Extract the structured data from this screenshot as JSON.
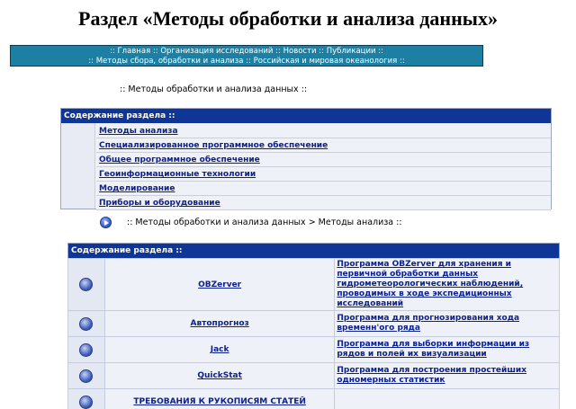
{
  "title": "Раздел «Методы обработки и анализа данных»",
  "nav": {
    "line1": [
      {
        "sep": ":: "
      },
      {
        "label": "Главная"
      },
      {
        "sep": " :: "
      },
      {
        "label": "Организация исследований"
      },
      {
        "sep": " :: "
      },
      {
        "label": "Новости"
      },
      {
        "sep": " :: "
      },
      {
        "label": "Публикации"
      },
      {
        "sep": " ::"
      }
    ],
    "line2": [
      {
        "sep": "::  "
      },
      {
        "label": "Методы сбора, обработки и анализа"
      },
      {
        "sep": " :: "
      },
      {
        "label": "Российская и мировая океанология"
      },
      {
        "sep": " ::"
      }
    ]
  },
  "breadcrumb1": ":: Методы обработки и анализа данных ::",
  "section1": {
    "header": "Содержание раздела ::",
    "items": [
      "Методы анализа",
      "Специализированное программное обеспечение",
      "Общее программное обеспечение",
      "Геоинформационные технологии",
      "Моделирование",
      "Приборы и оборудование"
    ]
  },
  "breadcrumb2": ":: Методы обработки и анализа данных > Методы анализа ::",
  "section2": {
    "header": "Содержание раздела ::",
    "rows": [
      {
        "name": "OBZerver",
        "desc": "Программа OBZerver для хранения и первичной обработки данных гидрометеорологических наблюдений, проводимых в ходе экспедиционных исследований"
      },
      {
        "name": "Автопрогноз",
        "desc": "Программа для прогнозирования хода временн'ого ряда"
      },
      {
        "name": "Jack",
        "desc": "Программа для выборки информации из рядов и полей их визуализации"
      },
      {
        "name": "QuickStat",
        "desc": "Программа для построения простейших одномерных статистик"
      },
      {
        "name": "ТРЕБОВАНИЯ К РУКОПИСЯМ СТАТЕЙ",
        "desc": ""
      }
    ]
  },
  "icons": {
    "bullet": "play-circle-icon",
    "row": "sphere-icon"
  },
  "colors": {
    "nav_bg": "#1d7fa2",
    "header_bg": "#0f3696",
    "link": "#0b1f8f",
    "row_bg": "#eef1f8"
  }
}
